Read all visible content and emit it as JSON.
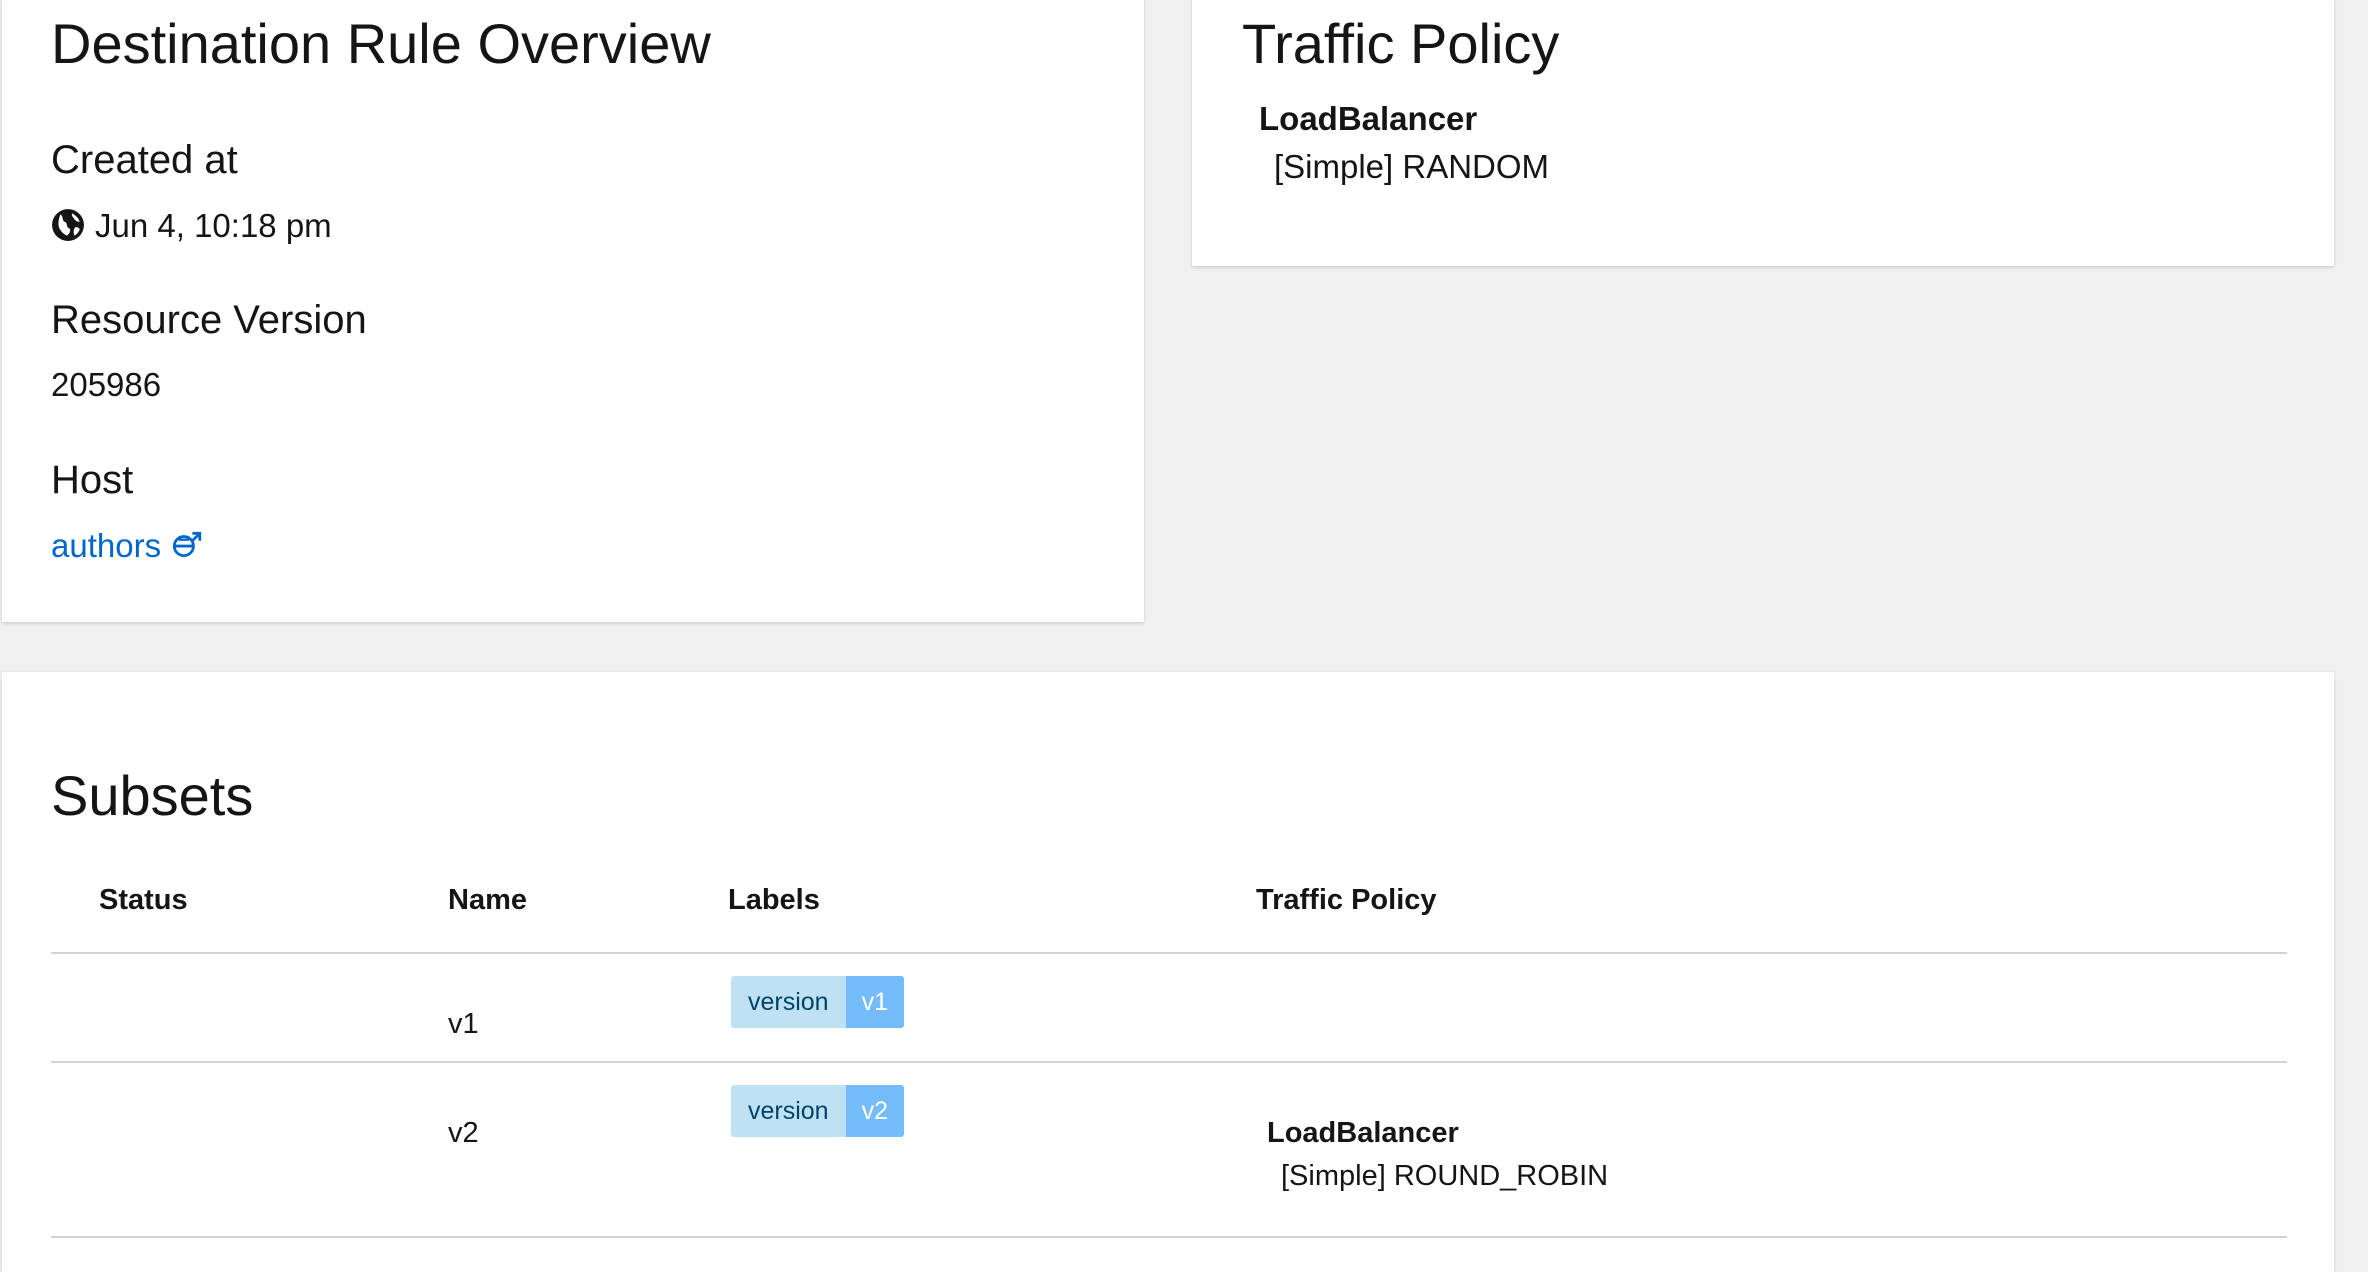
{
  "overview": {
    "title": "Destination Rule Overview",
    "created_label": "Created at",
    "created_value": "Jun 4, 10:18 pm",
    "resource_version_label": "Resource Version",
    "resource_version_value": "205986",
    "host_label": "Host",
    "host_value": "authors"
  },
  "traffic_policy": {
    "title": "Traffic Policy",
    "load_balancer_label": "LoadBalancer",
    "load_balancer_value": "[Simple] RANDOM"
  },
  "subsets": {
    "title": "Subsets",
    "columns": [
      "Status",
      "Name",
      "Labels",
      "Traffic Policy"
    ],
    "rows": [
      {
        "status": "",
        "name": "v1",
        "label_key": "version",
        "label_value": "v1",
        "traffic_policy_label": "",
        "traffic_policy_value": ""
      },
      {
        "status": "",
        "name": "v2",
        "label_key": "version",
        "label_value": "v2",
        "traffic_policy_label": "LoadBalancer",
        "traffic_policy_value": "[Simple] ROUND_ROBIN"
      }
    ]
  },
  "colors": {
    "link": "#0066cc",
    "label_key_bg": "#bee1f4",
    "label_value_bg": "#73bcf7"
  },
  "icons": {
    "created": "globe-icon",
    "host": "service-link-icon"
  }
}
